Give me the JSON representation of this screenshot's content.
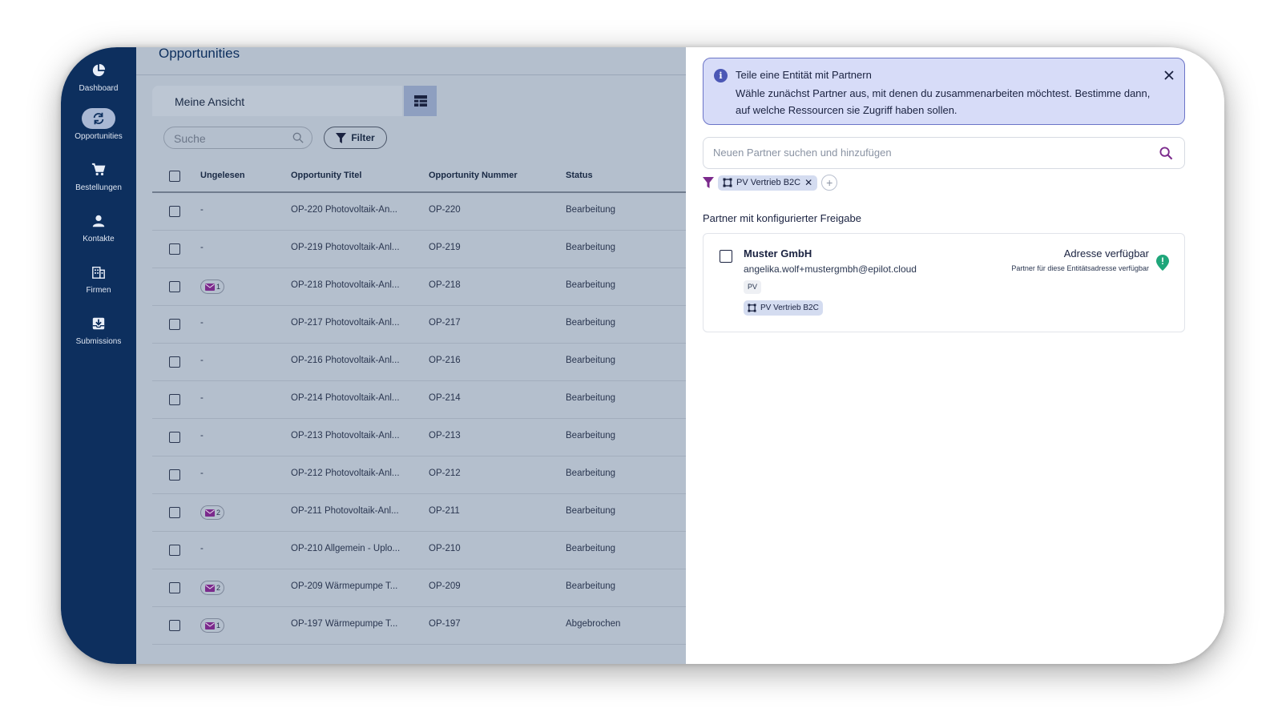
{
  "sidebar": {
    "items": [
      {
        "label": "Dashboard",
        "icon": "pie-chart-icon"
      },
      {
        "label": "Opportunities",
        "icon": "refresh-icon",
        "active": true
      },
      {
        "label": "Bestellungen",
        "icon": "cart-icon"
      },
      {
        "label": "Kontakte",
        "icon": "person-icon"
      },
      {
        "label": "Firmen",
        "icon": "building-icon"
      },
      {
        "label": "Submissions",
        "icon": "inbox-download-icon"
      }
    ]
  },
  "main": {
    "title": "Opportunities",
    "view_label": "Meine Ansicht",
    "search_placeholder": "Suche",
    "filter_label": "Filter",
    "columns": [
      "Ungelesen",
      "Opportunity Titel",
      "Opportunity Nummer",
      "Status"
    ],
    "rows": [
      {
        "unread": "-",
        "title": "OP-220 Photovoltaik-An...",
        "number": "OP-220",
        "status": "Bearbeitung"
      },
      {
        "unread": "-",
        "title": "OP-219 Photovoltaik-Anl...",
        "number": "OP-219",
        "status": "Bearbeitung"
      },
      {
        "unread": "1",
        "title": "OP-218 Photovoltaik-Anl...",
        "number": "OP-218",
        "status": "Bearbeitung"
      },
      {
        "unread": "-",
        "title": "OP-217 Photovoltaik-Anl...",
        "number": "OP-217",
        "status": "Bearbeitung"
      },
      {
        "unread": "-",
        "title": "OP-216 Photovoltaik-Anl...",
        "number": "OP-216",
        "status": "Bearbeitung"
      },
      {
        "unread": "-",
        "title": "OP-214 Photovoltaik-Anl...",
        "number": "OP-214",
        "status": "Bearbeitung"
      },
      {
        "unread": "-",
        "title": "OP-213 Photovoltaik-Anl...",
        "number": "OP-213",
        "status": "Bearbeitung"
      },
      {
        "unread": "-",
        "title": "OP-212 Photovoltaik-Anl...",
        "number": "OP-212",
        "status": "Bearbeitung"
      },
      {
        "unread": "2",
        "title": "OP-211 Photovoltaik-Anl...",
        "number": "OP-211",
        "status": "Bearbeitung"
      },
      {
        "unread": "-",
        "title": "OP-210 Allgemein - Uplo...",
        "number": "OP-210",
        "status": "Bearbeitung"
      },
      {
        "unread": "2",
        "title": "OP-209 Wärmepumpe T...",
        "number": "OP-209",
        "status": "Bearbeitung"
      },
      {
        "unread": "1",
        "title": "OP-197 Wärmepumpe T...",
        "number": "OP-197",
        "status": "Abgebrochen"
      }
    ]
  },
  "panel": {
    "alert_title": "Teile eine Entität mit Partnern",
    "alert_text": "Wähle zunächst Partner aus, mit denen du zusammenarbeiten möchtest. Bestimme dann, auf welche Ressourcen sie Zugriff haben sollen.",
    "search_placeholder": "Neuen Partner suchen und hinzufügen",
    "filter_chip": "PV Vertrieb B2C",
    "section_title": "Partner mit konfigurierter Freigabe",
    "partner": {
      "name": "Muster GmbH",
      "email": "angelika.wolf+mustergmbh@epilot.cloud",
      "tag": "PV",
      "chip": "PV Vertrieb B2C",
      "status": "Adresse verfügbar",
      "status_sub": "Partner für diese Entitätsadresse verfügbar"
    }
  },
  "colors": {
    "sidebar_bg": "#0d2f5e",
    "accent_purple": "#7b2a8c",
    "status_green": "#1fa67a",
    "alert_bg": "#d7dcf8"
  }
}
